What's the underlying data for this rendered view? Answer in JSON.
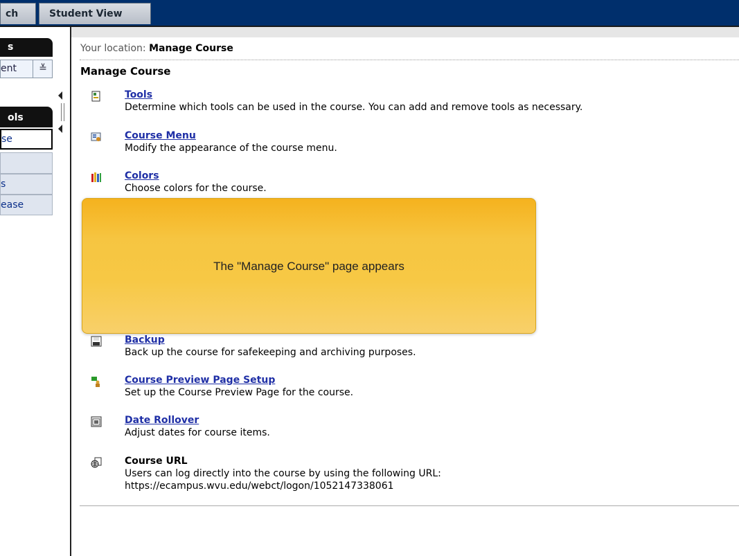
{
  "tabs": [
    {
      "label": "ch"
    },
    {
      "label": "Student View"
    }
  ],
  "left_panel": {
    "header1": "s",
    "select_value": "ent",
    "select_toggle": "≚",
    "header2": "ols",
    "items": [
      "se",
      "",
      "s",
      "ease"
    ]
  },
  "location": {
    "prefix": "Your location:",
    "current": "Manage Course"
  },
  "page_title": "Manage Course",
  "entries": [
    {
      "title": "Tools",
      "desc": "Determine which tools can be used in the course. You can add and remove tools as necessary.",
      "icon": "tools-icon"
    },
    {
      "title": "Course Menu",
      "desc": "Modify the appearance of the course menu.",
      "icon": "course-menu-icon"
    },
    {
      "title": "Colors",
      "desc": "Choose colors for the course.",
      "icon": "colors-icon"
    },
    {
      "title": "Backup",
      "desc": "Back up the course for safekeeping and archiving purposes.",
      "icon": "backup-icon"
    },
    {
      "title": "Course Preview Page Setup",
      "desc": "Set up the Course Preview Page for the course.",
      "icon": "preview-page-icon"
    },
    {
      "title": "Date Rollover",
      "desc": "Adjust dates for course items.",
      "icon": "calendar-icon"
    }
  ],
  "course_url": {
    "title": "Course URL",
    "desc": "Users can log directly into the course by using the following URL:",
    "url": "https://ecampus.wvu.edu/webct/logon/1052147338061",
    "icon": "globe-icon"
  },
  "callout": {
    "text": "The \"Manage Course\" page appears"
  }
}
